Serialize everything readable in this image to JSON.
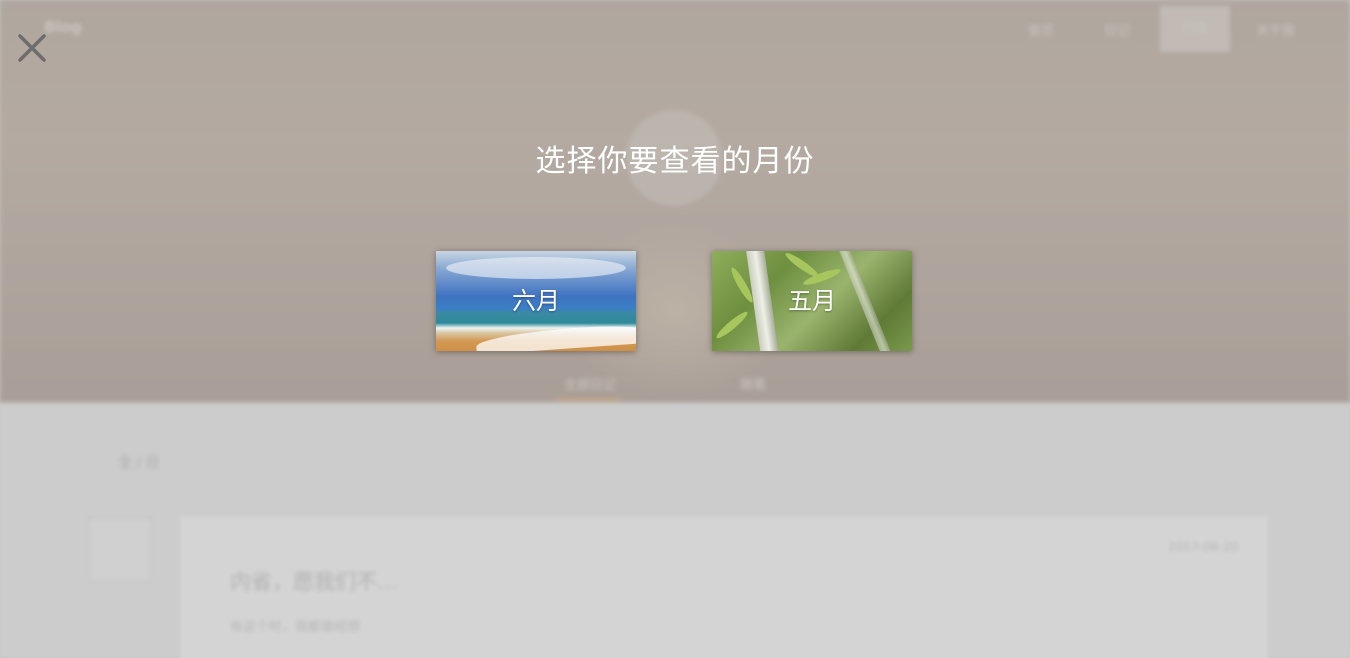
{
  "background_page": {
    "brand": "Blog",
    "nav_items": [
      "首页",
      "日记",
      "归档",
      "关于我"
    ],
    "hero_tabs": [
      "全部日记",
      "随笔"
    ],
    "crumb": "全 / 日",
    "post": {
      "title": "内省，愿我们不…",
      "excerpt": "有这个时，我都曾经想",
      "date": "2017-06-20"
    }
  },
  "modal": {
    "close_label": "×",
    "title": "选择你要查看的月份",
    "months": [
      {
        "label": "六月",
        "thumbnail": "beach"
      },
      {
        "label": "五月",
        "thumbnail": "bamboo"
      }
    ]
  },
  "colors": {
    "overlay_text": "#ffffff",
    "accent_underline": "#e0a860"
  }
}
